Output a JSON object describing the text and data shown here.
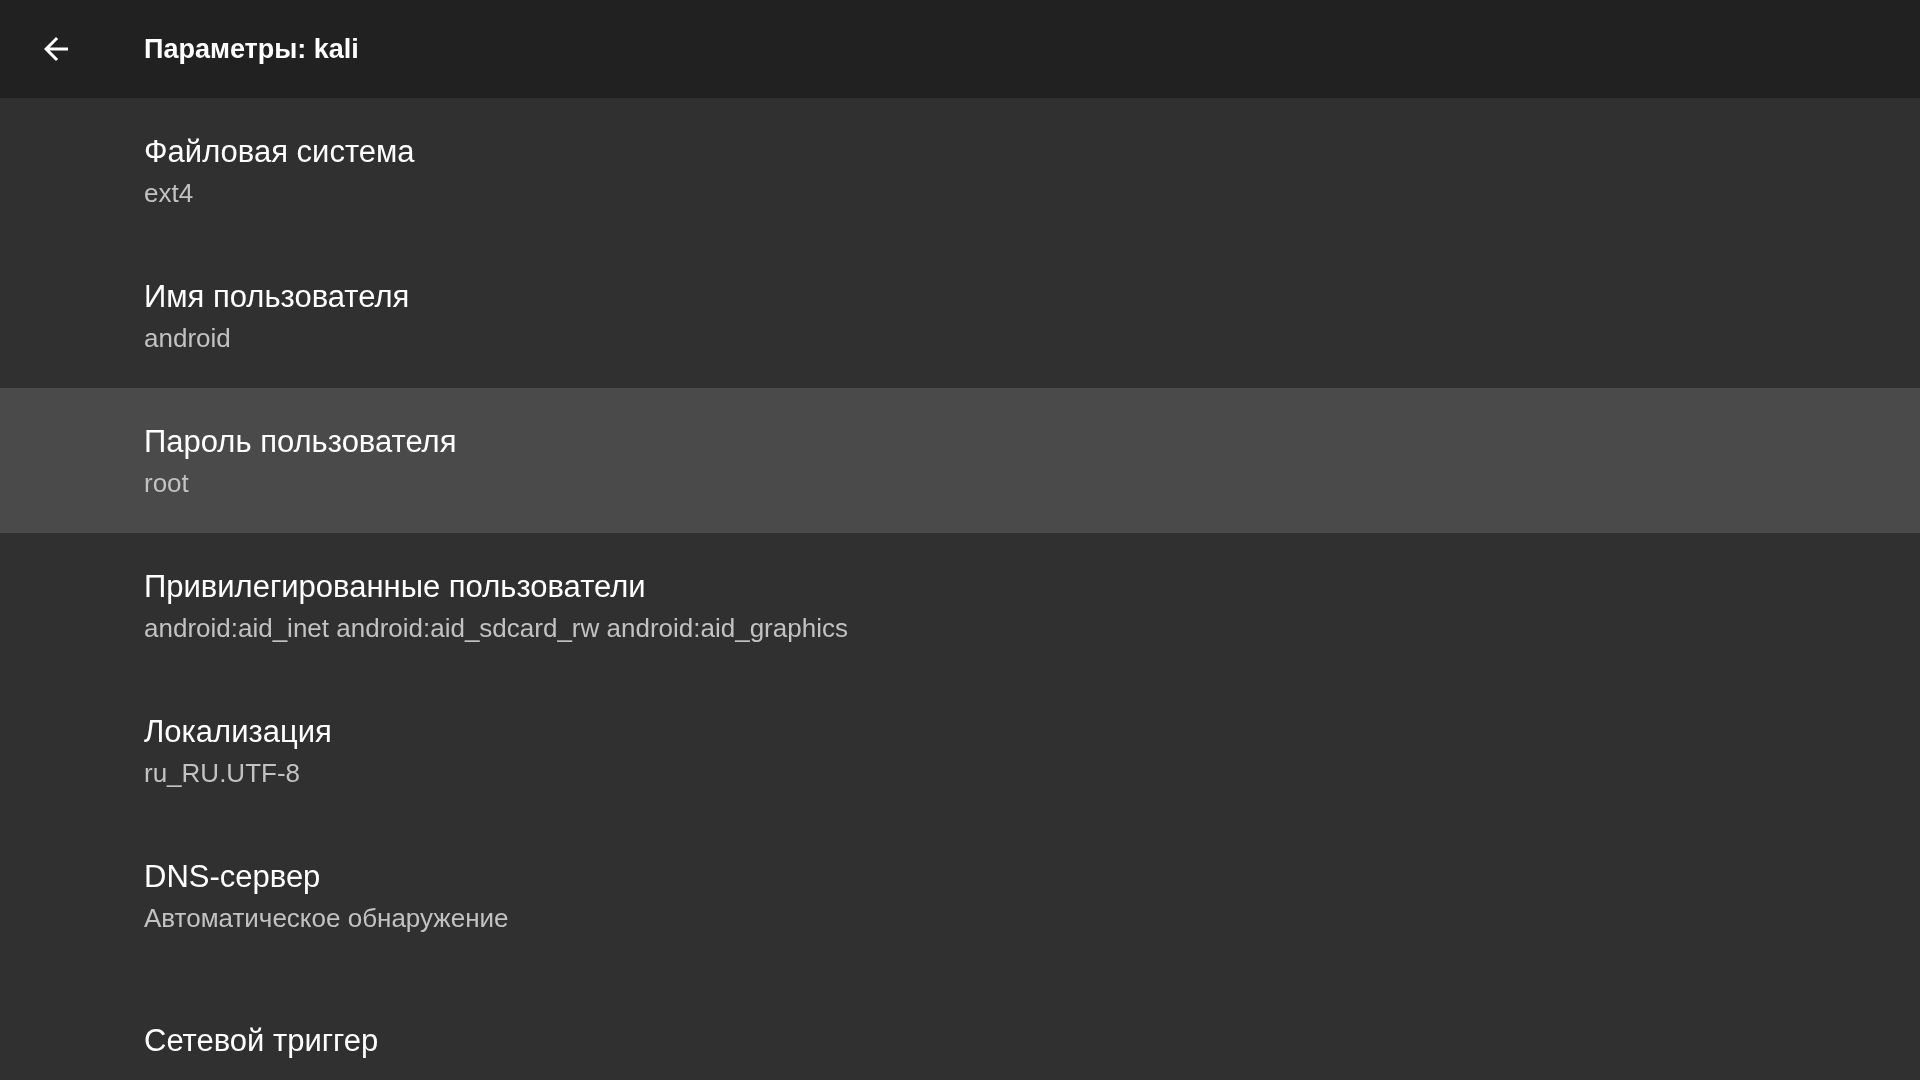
{
  "toolbar": {
    "title": "Параметры: kali"
  },
  "preferences": [
    {
      "title": "Файловая система",
      "summary": "ext4",
      "selected": false
    },
    {
      "title": "Имя пользователя",
      "summary": "android",
      "selected": false
    },
    {
      "title": "Пароль пользователя",
      "summary": "root",
      "selected": true
    },
    {
      "title": "Привилегированные пользователи",
      "summary": "android:aid_inet android:aid_sdcard_rw android:aid_graphics",
      "selected": false
    },
    {
      "title": "Локализация",
      "summary": "ru_RU.UTF-8",
      "selected": false
    },
    {
      "title": "DNS-сервер",
      "summary": "Автоматическое обнаружение",
      "selected": false
    },
    {
      "title": "Сетевой триггер",
      "selected": false
    }
  ]
}
